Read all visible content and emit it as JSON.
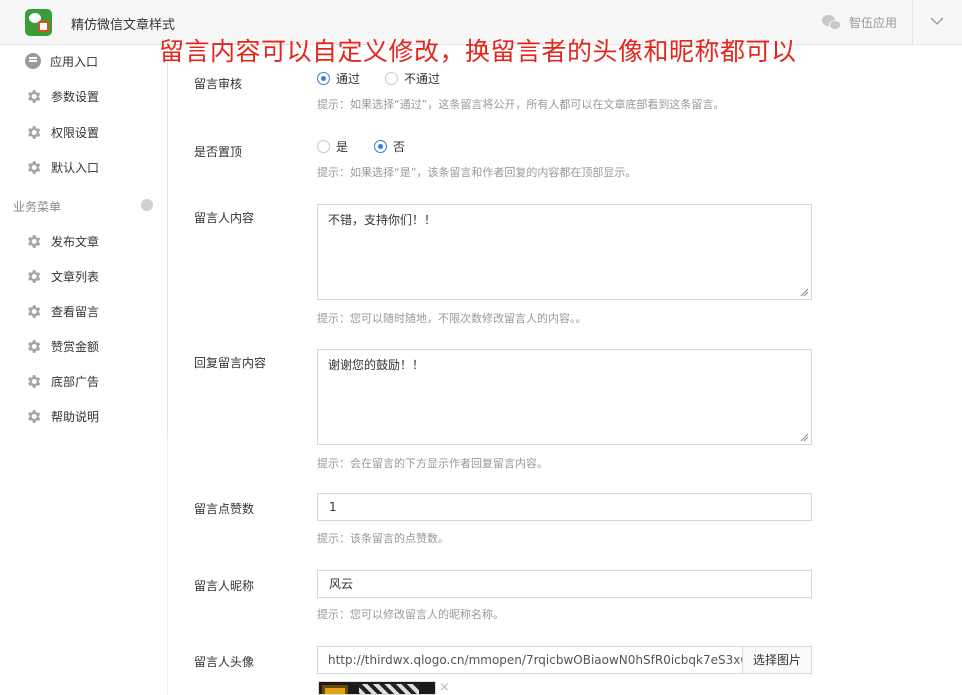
{
  "header": {
    "app_title": "精仿微信文章样式",
    "right_label": "智伍应用"
  },
  "banner": {
    "text": "留言内容可以自定义修改，换留言者的头像和昵称都可以"
  },
  "sidebar": {
    "top_items": [
      {
        "label": "应用入口",
        "icon": "chat-bubble-icon"
      },
      {
        "label": "参数设置",
        "icon": "gear-icon"
      },
      {
        "label": "权限设置",
        "icon": "gear-icon"
      },
      {
        "label": "默认入口",
        "icon": "gear-icon"
      }
    ],
    "section_label": "业务菜单",
    "business_items": [
      {
        "label": "发布文章",
        "icon": "gear-icon"
      },
      {
        "label": "文章列表",
        "icon": "gear-icon"
      },
      {
        "label": "查看留言",
        "icon": "gear-icon"
      },
      {
        "label": "赞赏金额",
        "icon": "gear-icon"
      },
      {
        "label": "底部广告",
        "icon": "gear-icon"
      },
      {
        "label": "帮助说明",
        "icon": "gear-icon"
      }
    ]
  },
  "form": {
    "review": {
      "label": "留言审核",
      "options": [
        "通过",
        "不通过"
      ],
      "selected": "通过",
      "hint": "提示：如果选择“通过”，这条留言将公开，所有人都可以在文章底部看到这条留言。"
    },
    "pinned": {
      "label": "是否置顶",
      "options": [
        "是",
        "否"
      ],
      "selected": "否",
      "hint": "提示：如果选择“是”，该条留言和作者回复的内容都在顶部显示。"
    },
    "comment": {
      "label": "留言人内容",
      "value": "不错，支持你们！！",
      "hint": "提示：您可以随时随地，不限次数修改留言人的内容。。"
    },
    "reply": {
      "label": "回复留言内容",
      "value": "谢谢您的鼓励！！",
      "hint": "提示：会在留言的下方显示作者回复留言内容。"
    },
    "likes": {
      "label": "留言点赞数",
      "value": "1",
      "hint": "提示：该条留言的点赞数。"
    },
    "nickname": {
      "label": "留言人昵称",
      "value": "风云",
      "hint": "提示：您可以修改留言人的昵称名称。"
    },
    "avatar": {
      "label": "留言人头像",
      "value": "http://thirdwx.qlogo.cn/mmopen/7rqicbwOBiaowN0hSfR0icbqk7eS3xC",
      "pick_label": "选择图片",
      "remove_label": "×"
    }
  },
  "colors": {
    "banner": "#e5261c",
    "radio_active": "#3b7dd8",
    "logo_green": "#3a9d37"
  }
}
